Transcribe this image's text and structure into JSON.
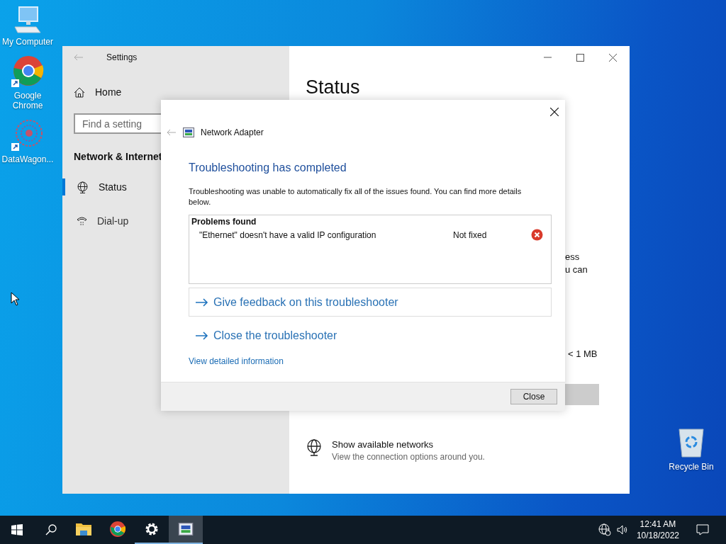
{
  "desktop_icons": [
    {
      "kind": "computer",
      "label": "My Computer"
    },
    {
      "kind": "browser",
      "label": "Google Chrome"
    },
    {
      "kind": "app",
      "label": "DataWagon..."
    }
  ],
  "recycle_bin": {
    "label": "Recycle Bin"
  },
  "settings": {
    "title": "Settings",
    "home": "Home",
    "search_placeholder": "Find a setting",
    "section": "Network & Internet",
    "nav": [
      {
        "kind": "globe",
        "label": "Status",
        "selected": true
      },
      {
        "kind": "phone",
        "label": "Dial-up",
        "selected": false
      }
    ],
    "heading": "Status",
    "fragments": [
      "ess",
      "u can",
      "< 1 MB"
    ],
    "network_option": {
      "title": "Show available networks",
      "description": "View the connection options around you."
    }
  },
  "dialog": {
    "title": "Network Adapter",
    "heading": "Troubleshooting has completed",
    "message": "Troubleshooting was unable to automatically fix all of the issues found. You can find more details below.",
    "problems_header": "Problems found",
    "problems": [
      {
        "text": "\"Ethernet\" doesn't have a valid IP configuration",
        "status": "Not fixed",
        "fixed": false
      }
    ],
    "links": [
      {
        "label": "Give feedback on this troubleshooter",
        "boxed": true
      },
      {
        "label": "Close the troubleshooter",
        "boxed": false
      }
    ],
    "detail_link": "View detailed information",
    "button": "Close"
  },
  "taskbar": {
    "apps": [
      {
        "kind": "folder",
        "open": false,
        "selected": false
      },
      {
        "kind": "browser",
        "open": false,
        "selected": false
      },
      {
        "kind": "gear",
        "open": true,
        "selected": false
      },
      {
        "kind": "adapter",
        "open": true,
        "selected": true
      }
    ],
    "time": "12:41 AM",
    "date": "10/18/2022"
  }
}
